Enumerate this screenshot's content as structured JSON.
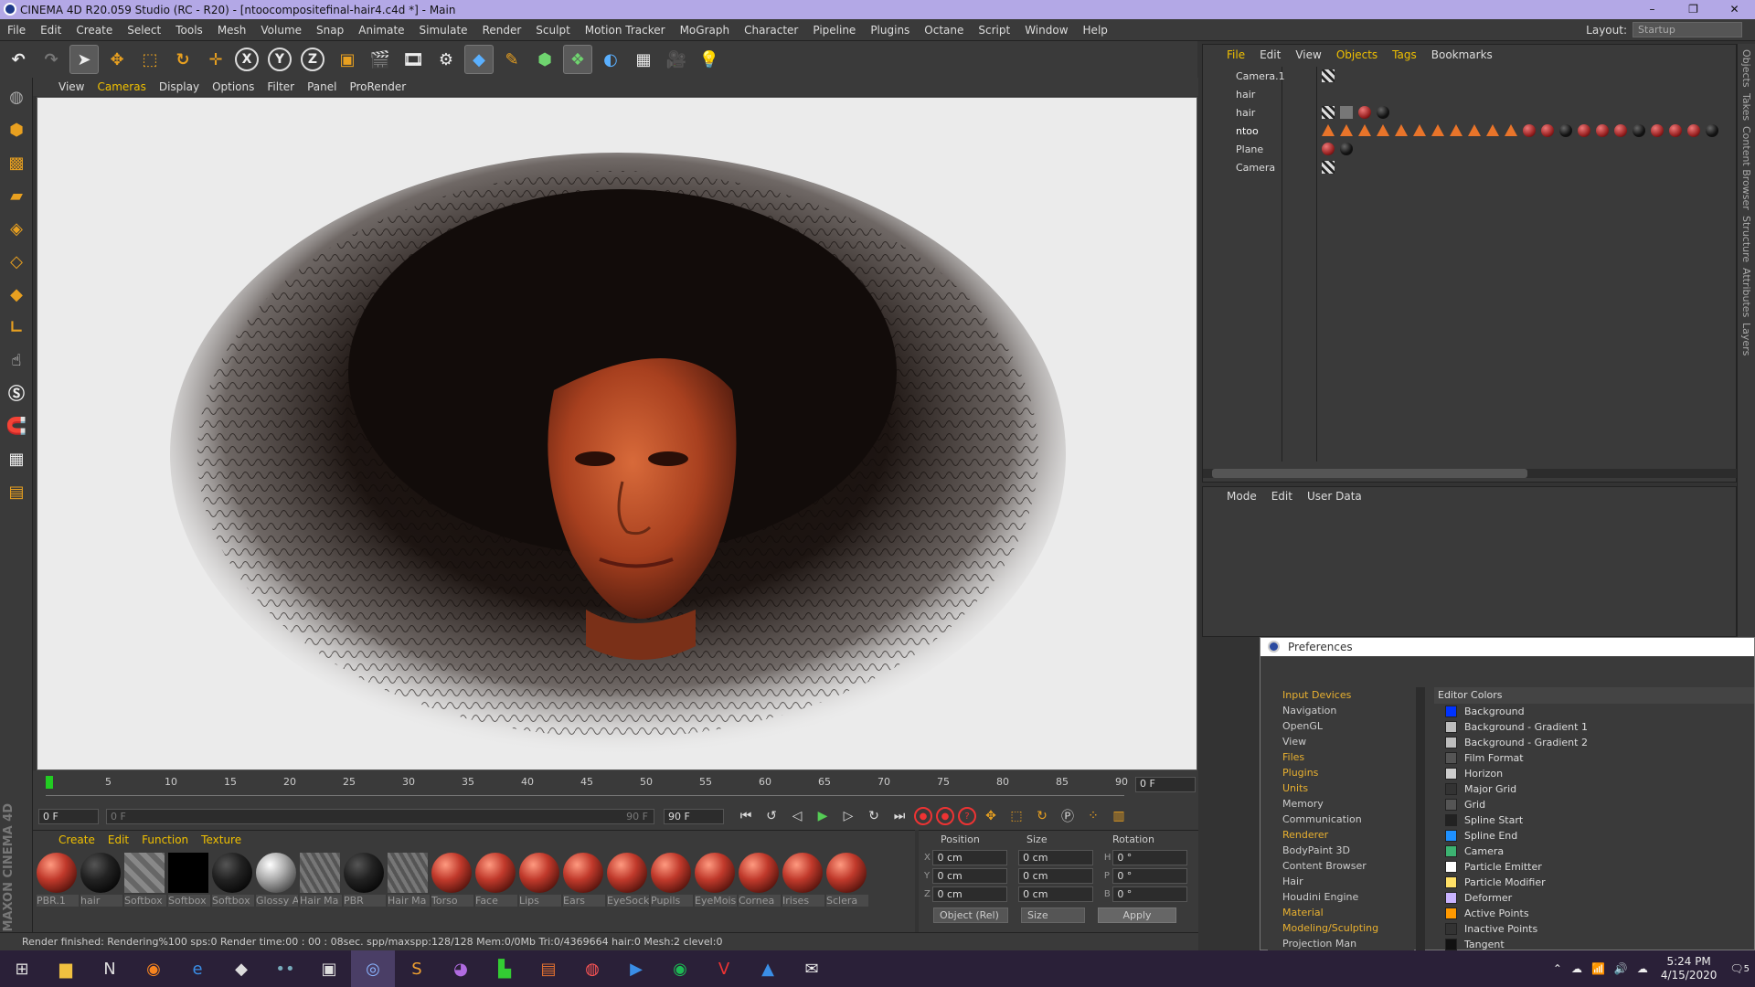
{
  "window": {
    "title": "CINEMA 4D R20.059 Studio (RC - R20) - [ntoocompositefinal-hair4.c4d *] - Main",
    "minimize": "–",
    "maximize": "❐",
    "close": "✕"
  },
  "menubar": {
    "items": [
      "File",
      "Edit",
      "Create",
      "Select",
      "Tools",
      "Mesh",
      "Volume",
      "Snap",
      "Animate",
      "Simulate",
      "Render",
      "Sculpt",
      "Motion Tracker",
      "MoGraph",
      "Character",
      "Pipeline",
      "Plugins",
      "Octane",
      "Script",
      "Window",
      "Help"
    ],
    "layout_label": "Layout:",
    "layout_value": "Startup"
  },
  "toolbar": {
    "axis_x": "X",
    "axis_y": "Y",
    "axis_z": "Z"
  },
  "viewport_menu": [
    "View",
    "Cameras",
    "Display",
    "Options",
    "Filter",
    "Panel",
    "ProRender"
  ],
  "timeline": {
    "ticks": [
      "0",
      "5",
      "10",
      "15",
      "20",
      "25",
      "30",
      "35",
      "40",
      "45",
      "50",
      "55",
      "60",
      "65",
      "70",
      "75",
      "80",
      "85",
      "90"
    ],
    "current_frame": "0 F",
    "start_field": "0 F",
    "range_start": "0 F",
    "range_end": "90 F",
    "end_field": "90 F"
  },
  "material_menu": [
    "Create",
    "Edit",
    "Function",
    "Texture"
  ],
  "materials": [
    {
      "name": "PBR.1",
      "style": "orng"
    },
    {
      "name": "hair",
      "style": "dark"
    },
    {
      "name": "Softbox",
      "style": "check"
    },
    {
      "name": "Softbox",
      "style": "black"
    },
    {
      "name": "Softbox",
      "style": "dark"
    },
    {
      "name": "Glossy A",
      "style": "glossy"
    },
    {
      "name": "Hair Ma",
      "style": "hairg"
    },
    {
      "name": "PBR",
      "style": "dark"
    },
    {
      "name": "Hair Ma",
      "style": "hairg"
    },
    {
      "name": "Torso",
      "style": "orng"
    },
    {
      "name": "Face",
      "style": "orng"
    },
    {
      "name": "Lips",
      "style": "orng"
    },
    {
      "name": "Ears",
      "style": "orng"
    },
    {
      "name": "EyeSock",
      "style": "orng"
    },
    {
      "name": "Pupils",
      "style": "orng"
    },
    {
      "name": "EyeMois",
      "style": "orng"
    },
    {
      "name": "Cornea",
      "style": "orng"
    },
    {
      "name": "Irises",
      "style": "orng"
    },
    {
      "name": "Sclera",
      "style": "orng"
    }
  ],
  "coords": {
    "headers": [
      "Position",
      "Size",
      "Rotation"
    ],
    "rows": [
      {
        "axis": "X",
        "pos": "0 cm",
        "size": "0 cm",
        "raxis": "H",
        "rot": "0 °"
      },
      {
        "axis": "Y",
        "pos": "0 cm",
        "size": "0 cm",
        "raxis": "P",
        "rot": "0 °"
      },
      {
        "axis": "Z",
        "pos": "0 cm",
        "size": "0 cm",
        "raxis": "B",
        "rot": "0 °"
      }
    ],
    "mode_dropdown": "Object (Rel)",
    "size_dropdown": "Size",
    "apply": "Apply"
  },
  "status": "Render finished: Rendering%100 sps:0 Render time:00 : 00 : 08sec. spp/maxspp:128/128 Mem:0/0Mb Tri:0/4369664 hair:0 Mesh:2 clevel:0",
  "objects_menu": [
    "File",
    "Edit",
    "View",
    "Objects",
    "Tags",
    "Bookmarks"
  ],
  "objects": [
    "Camera.1",
    "hair",
    "hair",
    "ntoo",
    "Plane",
    "Camera"
  ],
  "attr_menu": [
    "Mode",
    "Edit",
    "User Data"
  ],
  "right_tabs": [
    "Objects",
    "Takes",
    "Content Browser",
    "Structure",
    "Attributes",
    "Layers"
  ],
  "prefs": {
    "title": "Preferences",
    "categories": [
      {
        "label": "Input Devices",
        "y": true
      },
      {
        "label": "Navigation",
        "y": false
      },
      {
        "label": "OpenGL",
        "y": false
      },
      {
        "label": "View",
        "y": false
      },
      {
        "label": "Files",
        "y": true
      },
      {
        "label": "Plugins",
        "y": true
      },
      {
        "label": "Units",
        "y": true
      },
      {
        "label": "Memory",
        "y": false
      },
      {
        "label": "Communication",
        "y": false
      },
      {
        "label": "Renderer",
        "y": true
      },
      {
        "label": "BodyPaint 3D",
        "y": false
      },
      {
        "label": "Content Browser",
        "y": false
      },
      {
        "label": "Hair",
        "y": false
      },
      {
        "label": "Houdini Engine",
        "y": false
      },
      {
        "label": "Material",
        "y": true
      },
      {
        "label": "Modeling/Sculpting",
        "y": true
      },
      {
        "label": "Projection Man",
        "y": false
      }
    ],
    "section": "Editor Colors",
    "colors": [
      {
        "label": "Background",
        "color": "#0033ff"
      },
      {
        "label": "Background - Gradient 1",
        "color": "#bdbdbd"
      },
      {
        "label": "Background - Gradient 2",
        "color": "#bdbdbd"
      },
      {
        "label": "Film Format",
        "color": "#555555"
      },
      {
        "label": "Horizon",
        "color": "#cccccc"
      },
      {
        "label": "Major Grid",
        "color": "#333333"
      },
      {
        "label": "Grid",
        "color": "#555555"
      },
      {
        "label": "Spline Start",
        "color": "#222222"
      },
      {
        "label": "Spline End",
        "color": "#1e90ff"
      },
      {
        "label": "Camera",
        "color": "#3cb371"
      },
      {
        "label": "Particle Emitter",
        "color": "#ffffff"
      },
      {
        "label": "Particle Modifier",
        "color": "#ffe066"
      },
      {
        "label": "Deformer",
        "color": "#c9b3ff"
      },
      {
        "label": "Active Points",
        "color": "#ff9900"
      },
      {
        "label": "Inactive Points",
        "color": "#333333"
      },
      {
        "label": "Tangent",
        "color": "#111111"
      }
    ]
  },
  "taskbar": {
    "time": "5:24 PM",
    "date": "4/15/2020",
    "notif": "5"
  }
}
